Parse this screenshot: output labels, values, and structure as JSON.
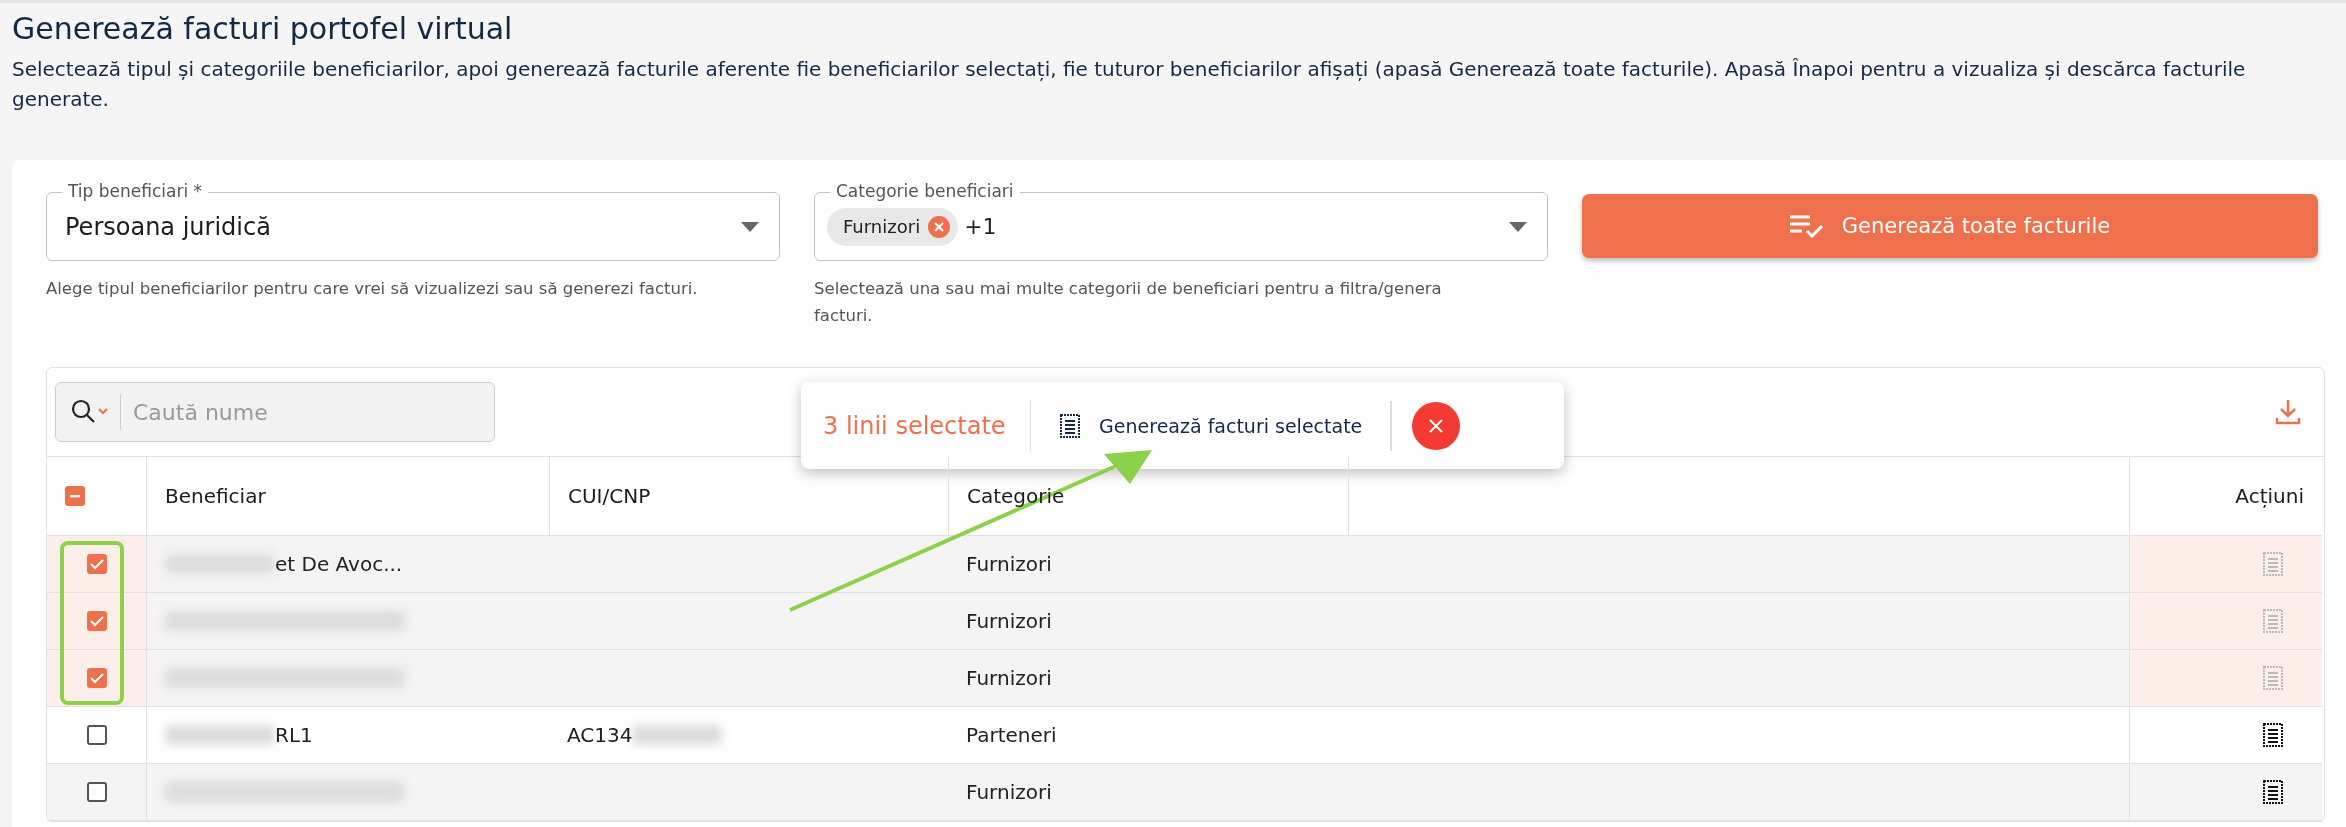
{
  "page": {
    "title": "Generează facturi portofel virtual",
    "description": "Selectează tipul și categoriile beneficiarilor, apoi generează facturile aferente fie beneficiarilor selectați, fie tuturor beneficiarilor afișați (apasă Generează toate facturile). Apasă Înapoi pentru a vizualiza și descărca facturile generate."
  },
  "filters": {
    "type_field": {
      "label": "Tip beneficiari *",
      "value": "Persoana juridică",
      "helper": "Alege tipul beneficiarilor pentru care vrei să vizualizezi sau să generezi facturi."
    },
    "category_field": {
      "label": "Categorie beneficiari",
      "chips": [
        "Furnizori"
      ],
      "more": "+1",
      "helper": "Selectează una sau mai multe categorii de beneficiari pentru a filtra/genera facturi."
    },
    "generate_all_button": "Generează toate facturile"
  },
  "table": {
    "search": {
      "placeholder": "Caută nume"
    },
    "selection_bar": {
      "count": "3 linii selectate",
      "action": "Generează facturi selectate"
    },
    "columns": [
      "Beneficiar",
      "CUI/CNP",
      "Categorie",
      "",
      "Acțiuni"
    ],
    "header_checkbox": {
      "indeterminate": true
    },
    "rows": [
      {
        "selected": true,
        "beneficiar": "et De Avoc...",
        "cui": "",
        "categorie": "Furnizori"
      },
      {
        "selected": true,
        "beneficiar": "",
        "cui": "",
        "categorie": "Furnizori"
      },
      {
        "selected": true,
        "beneficiar": "",
        "cui": "",
        "categorie": "Furnizori"
      },
      {
        "selected": false,
        "beneficiar": "RL1",
        "cui": "AC134",
        "categorie": "Parteneri"
      },
      {
        "selected": false,
        "beneficiar": "",
        "cui": "",
        "categorie": "Furnizori"
      }
    ]
  }
}
